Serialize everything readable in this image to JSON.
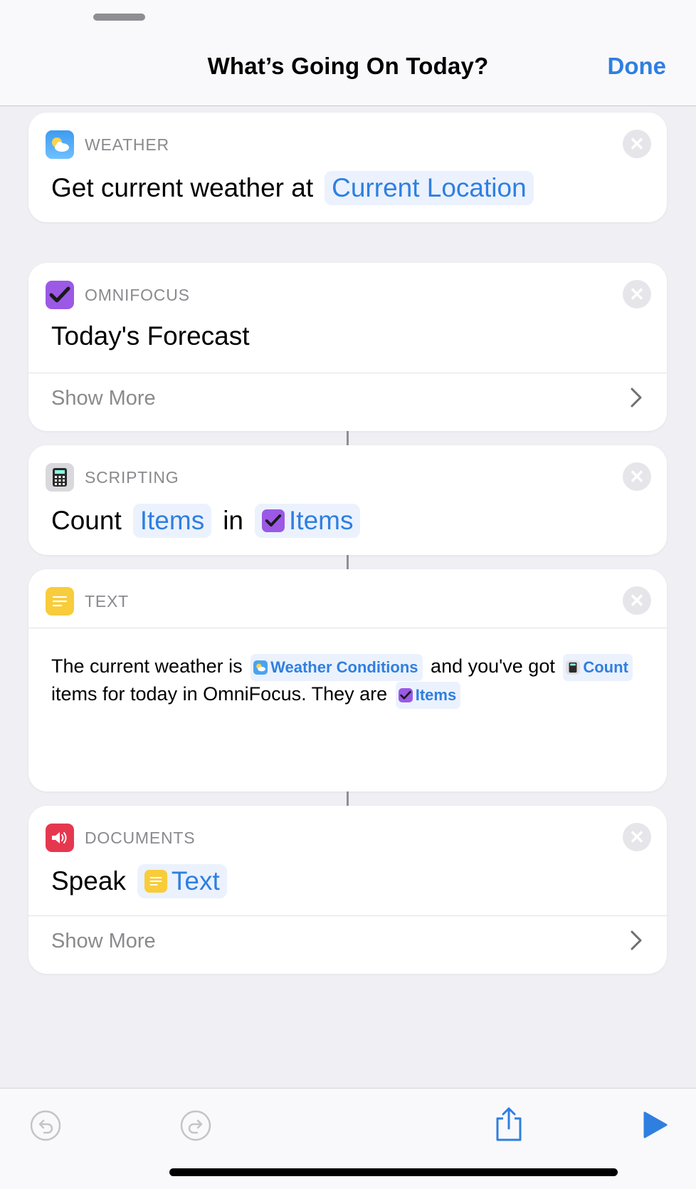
{
  "header": {
    "title": "What’s Going On Today?",
    "done_label": "Done"
  },
  "colors": {
    "accent": "#2f7fe0",
    "omnifocus": "#9b59e6",
    "text_app": "#f8cc3a",
    "documents": "#e5384f",
    "weather": "#4aa3f0"
  },
  "actions": [
    {
      "category": "WEATHER",
      "icon": "weather-cloud-icon",
      "verb": "Get current weather at",
      "param": "Current Location"
    },
    {
      "category": "OMNIFOCUS",
      "icon": "omnifocus-check-icon",
      "title": "Today's Forecast",
      "show_more": "Show More"
    },
    {
      "category": "SCRIPTING",
      "icon": "calculator-icon",
      "verb": "Count",
      "param1": "Items",
      "mid": "in",
      "param2": "Items"
    },
    {
      "category": "TEXT",
      "icon": "text-lines-icon",
      "t1": "The current weather is",
      "v1": "Weather Conditions",
      "t2": "and you've got",
      "v2": "Count",
      "t3": "items for today in OmniFocus. They are",
      "v3": "Items"
    },
    {
      "category": "DOCUMENTS",
      "icon": "speaker-icon",
      "verb": "Speak",
      "param": "Text",
      "show_more": "Show More"
    }
  ],
  "toolbar": {
    "undo": "undo-icon",
    "redo": "redo-icon",
    "share": "share-icon",
    "run": "play-icon"
  }
}
